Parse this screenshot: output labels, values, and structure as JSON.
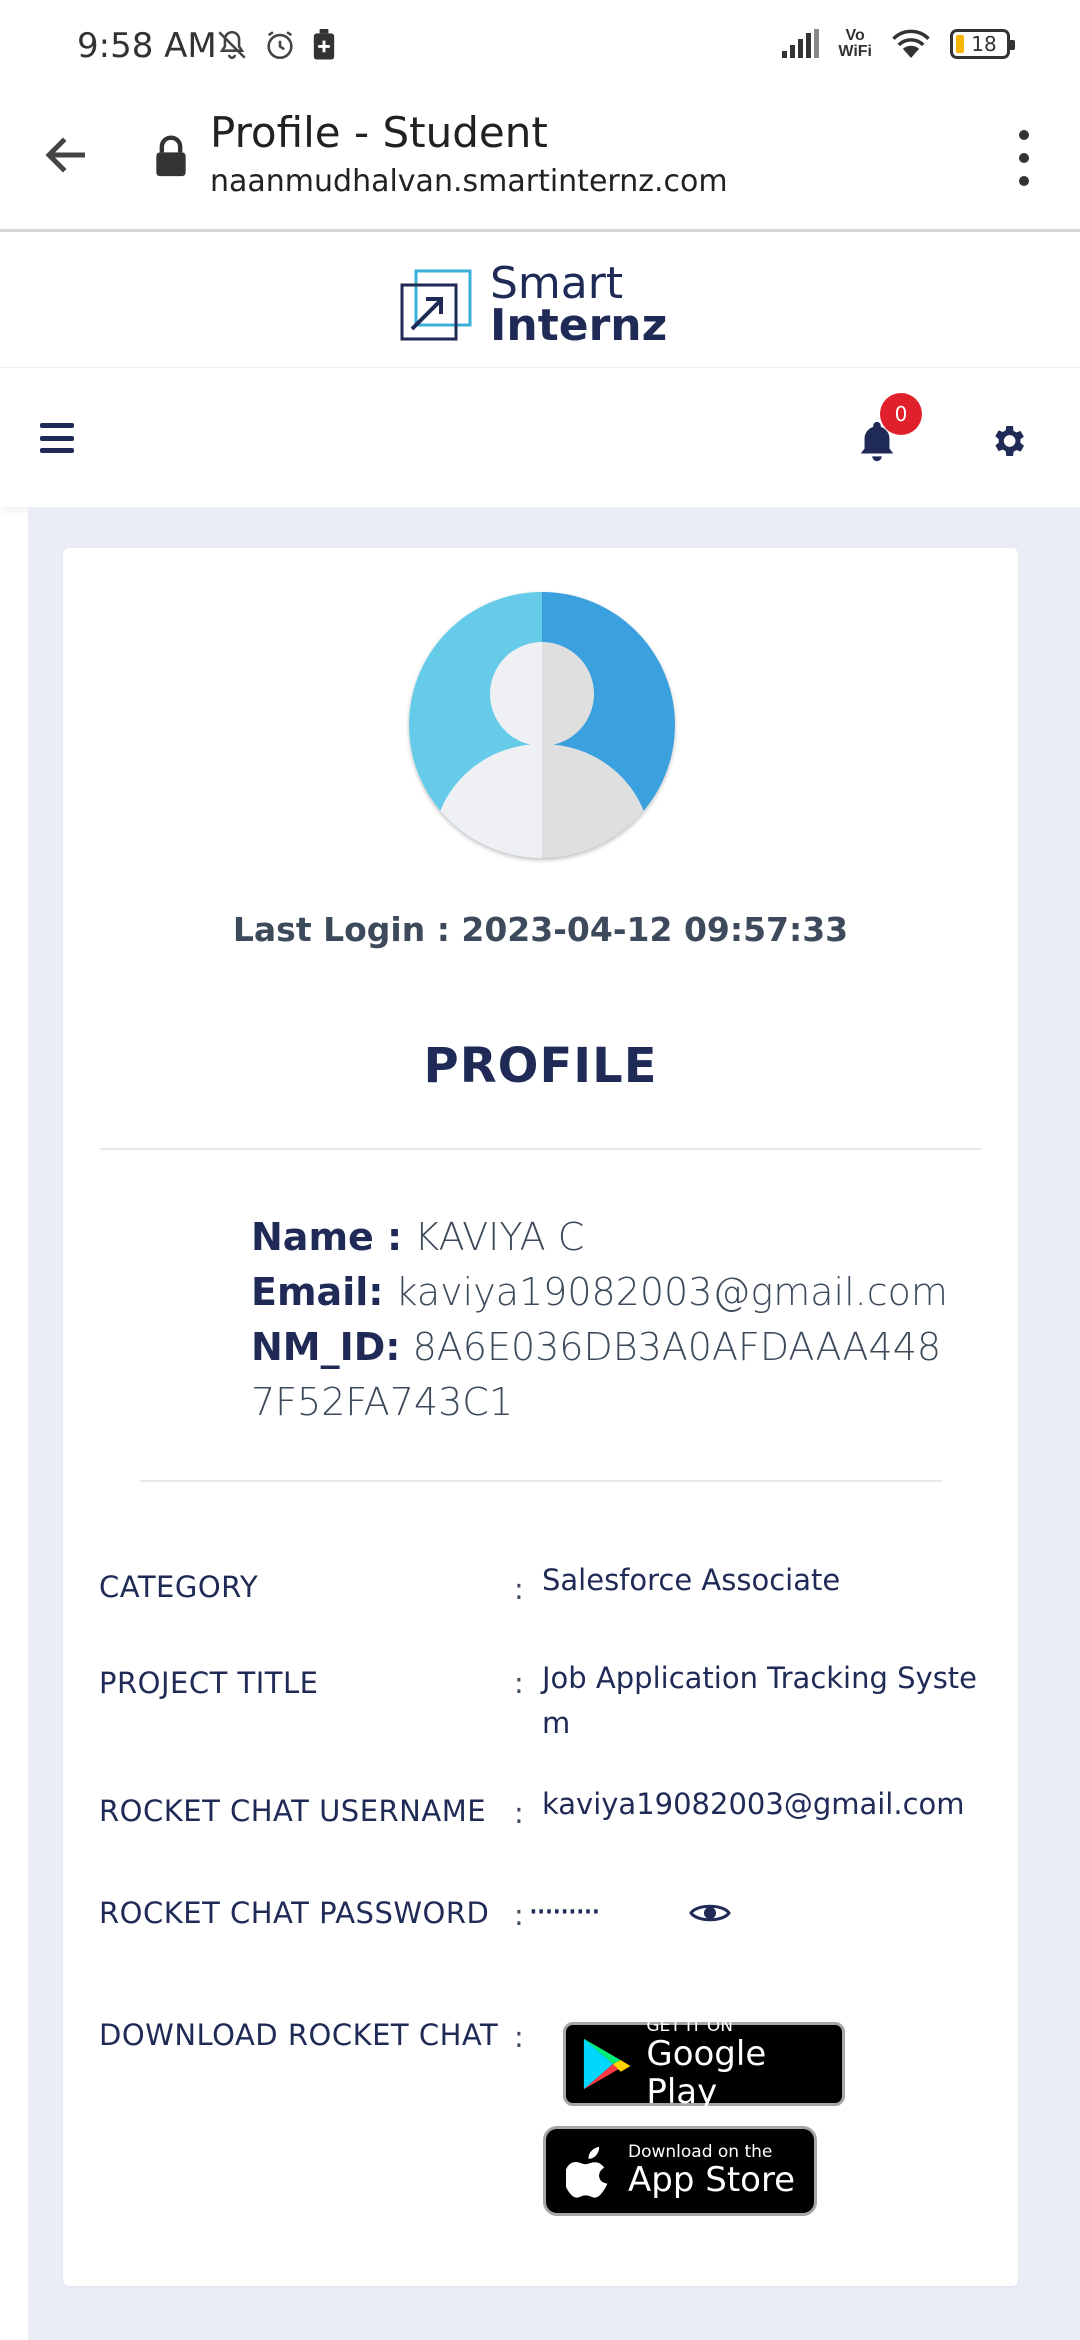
{
  "status_bar": {
    "time": "9:58 AM",
    "vowifi_top": "Vo",
    "vowifi_bottom": "WiFi",
    "battery": "18"
  },
  "browser": {
    "page_title": "Profile - Student",
    "host": "naanmudhalvan.smartinternz.com"
  },
  "site": {
    "logo_line1": "Smart",
    "logo_line2": "Internz",
    "notification_count": "0",
    "accent_color": "#1f2a56",
    "badge_color": "#e0202a"
  },
  "profile": {
    "last_login": "Last Login : 2023-04-12 09:57:33",
    "heading": "PROFILE",
    "name_label": "Name :",
    "name_value": "KAVIYA C",
    "email_label": "Email:",
    "email_value": "kaviya19082003@gmail.com",
    "nmid_label": "NM_ID:",
    "nmid_value": "8A6E036DB3A0AFDAAA4487F52FA743C1"
  },
  "details": {
    "colon": ":",
    "category_label": "CATEGORY",
    "category_value": "Salesforce Associate",
    "project_label": "PROJECT TITLE",
    "project_value": "Job Application Tracking System",
    "rc_username_label": "ROCKET CHAT USERNAME",
    "rc_username_value": "kaviya19082003@gmail.com",
    "rc_password_label": "ROCKET CHAT PASSWORD",
    "rc_password_value": "·········",
    "download_label": "DOWNLOAD ROCKET CHAT"
  },
  "badges": {
    "play_small": "GET IT ON",
    "play_big": "Google Play",
    "apple_small": "Download on the",
    "apple_big": "App Store"
  }
}
